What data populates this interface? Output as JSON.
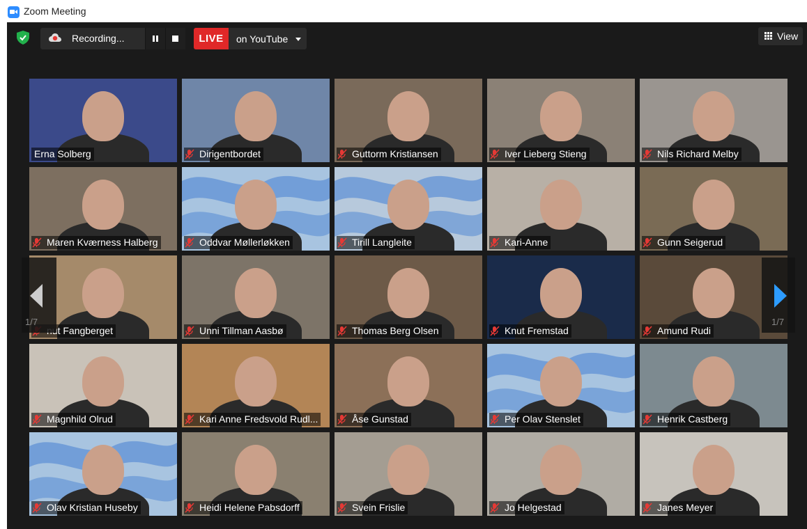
{
  "window": {
    "title": "Zoom Meeting"
  },
  "toolbar": {
    "recording_label": "Recording...",
    "live_label": "LIVE",
    "stream_target": "on YouTube",
    "view_label": "View"
  },
  "pagination": {
    "left": "1/7",
    "right": "1/7"
  },
  "colors": {
    "live_red": "#e02828",
    "accent_blue": "#2d9cff",
    "shield_green": "#22b14c",
    "muted_red": "#e53935"
  },
  "participants": [
    {
      "name": "Erna Solberg",
      "muted": false
    },
    {
      "name": "Dirigentbordet",
      "muted": true
    },
    {
      "name": "Guttorm Kristiansen",
      "muted": true
    },
    {
      "name": "Iver Lieberg Stieng",
      "muted": true
    },
    {
      "name": "Nils Richard Melby",
      "muted": true
    },
    {
      "name": "Maren Kværness Halberg",
      "muted": true
    },
    {
      "name": "Oddvar Møllerløkken",
      "muted": true
    },
    {
      "name": "Tirill Langleite",
      "muted": true
    },
    {
      "name": "Kari-Anne",
      "muted": true
    },
    {
      "name": "Gunn Seigerud",
      "muted": true
    },
    {
      "name": "nut Fangberget",
      "muted": true
    },
    {
      "name": "Unni Tillman Aasbø",
      "muted": true
    },
    {
      "name": "Thomas Berg Olsen",
      "muted": true
    },
    {
      "name": "Knut Fremstad",
      "muted": true
    },
    {
      "name": "Amund Rudi",
      "muted": true
    },
    {
      "name": "Magnhild Olrud",
      "muted": true
    },
    {
      "name": "Kari Anne Fredsvold Rudl...",
      "muted": true
    },
    {
      "name": "Åse Gunstad",
      "muted": true
    },
    {
      "name": "Per Olav Stenslet",
      "muted": true
    },
    {
      "name": "Henrik Castberg",
      "muted": true
    },
    {
      "name": "Olav Kristian Huseby",
      "muted": true
    },
    {
      "name": "Heidi Helene Pabsdorff",
      "muted": true
    },
    {
      "name": "Svein Frislie",
      "muted": true
    },
    {
      "name": "Jo Helgestad",
      "muted": true
    },
    {
      "name": "Janes Meyer",
      "muted": true
    }
  ]
}
